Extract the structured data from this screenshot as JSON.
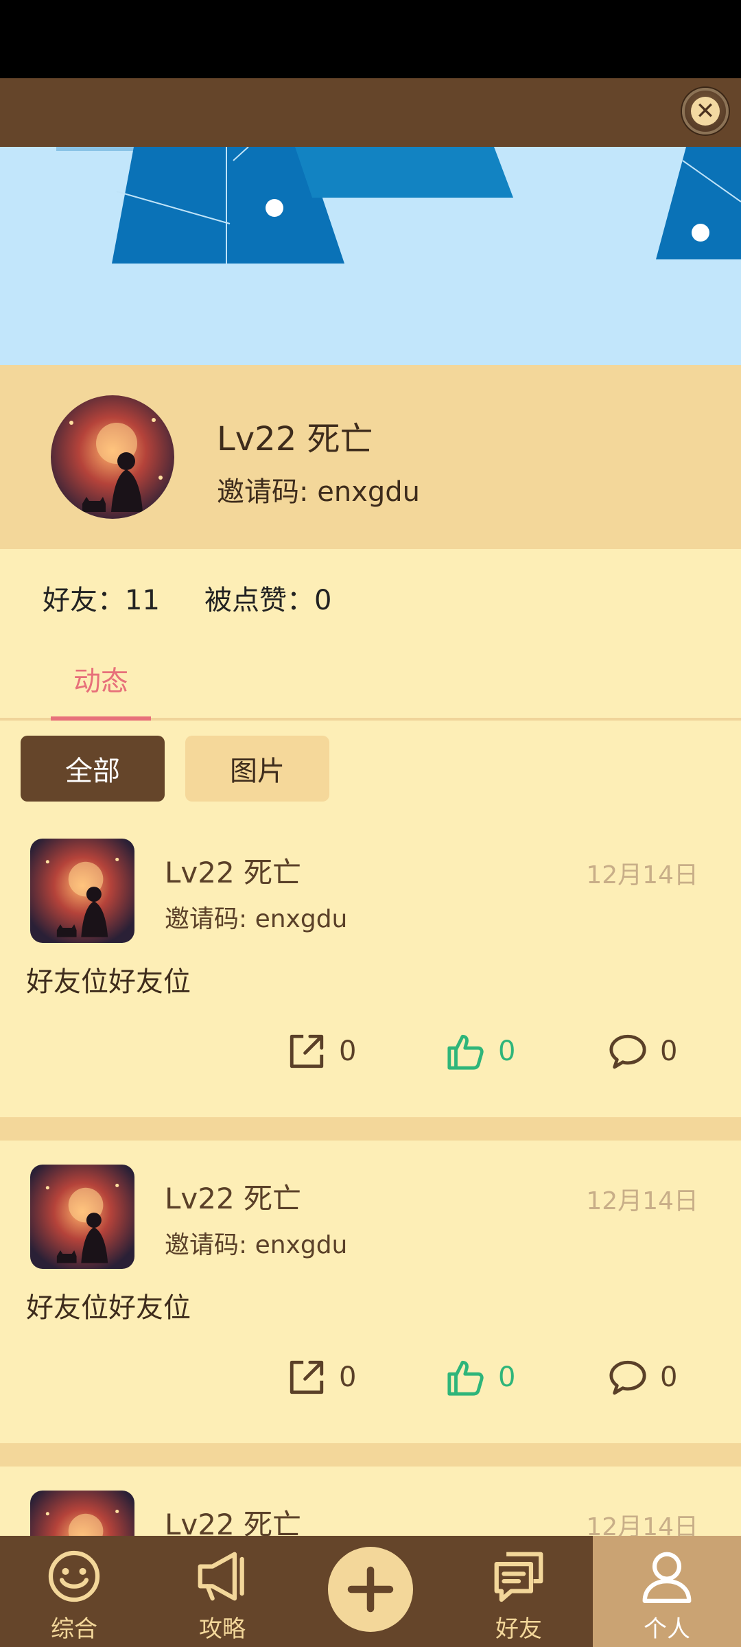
{
  "profile": {
    "name": "Lv22 死亡",
    "invite_label": "邀请码:",
    "invite_code": "enxgdu"
  },
  "stats": {
    "friends_label": "好友：",
    "friends_value": "11",
    "likes_label": "被点赞：",
    "likes_value": "0"
  },
  "tabs": {
    "active": "动态"
  },
  "filters": {
    "all": "全部",
    "pictures": "图片"
  },
  "posts": [
    {
      "name": "Lv22 死亡",
      "invite": "邀请码: enxgdu",
      "date": "12月14日",
      "text": "好友位好友位",
      "shares": "0",
      "likes": "0",
      "comments": "0"
    },
    {
      "name": "Lv22 死亡",
      "invite": "邀请码: enxgdu",
      "date": "12月14日",
      "text": "好友位好友位",
      "shares": "0",
      "likes": "0",
      "comments": "0"
    },
    {
      "name": "Lv22 死亡",
      "date": "12月14日"
    }
  ],
  "nav": {
    "general": "综合",
    "guide": "攻略",
    "friends": "好友",
    "personal": "个人"
  },
  "colors": {
    "brown": "#65452a",
    "cream": "#fdeeb6",
    "tan": "#f3d79a",
    "pink": "#e7707a",
    "green": "#2eb57a",
    "banner_blue": "#c2e6fb",
    "triangle_blue": "#0a72b7"
  }
}
